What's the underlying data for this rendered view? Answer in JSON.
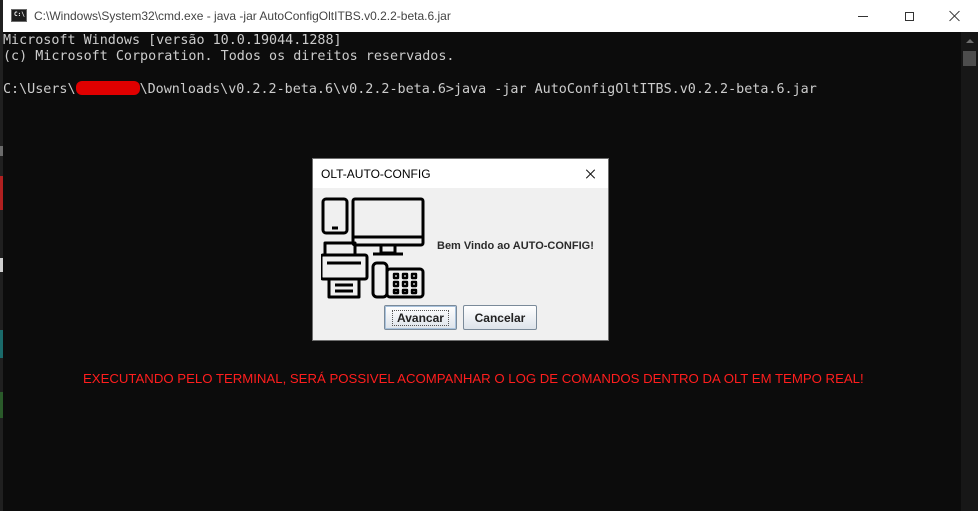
{
  "window": {
    "title": "C:\\Windows\\System32\\cmd.exe - java  -jar AutoConfigOltITBS.v0.2.2-beta.6.jar",
    "icon": "cmd-icon",
    "icon_text": "C:\\",
    "controls": [
      "minimize-icon",
      "maximize-icon",
      "close-icon"
    ]
  },
  "terminal": {
    "line1": "Microsoft Windows [versão 10.0.19044.1288]",
    "line2": "(c) Microsoft Corporation. Todos os direitos reservados.",
    "prompt_prefix": "C:\\Users\\",
    "prompt_suffix": "\\Downloads\\v0.2.2-beta.6\\v0.2.2-beta.6>java -jar AutoConfigOltITBS.v0.2.2-beta.6.jar",
    "redaction_color": "#e00000",
    "text_color": "#cccccc",
    "background": "#0c0c0c"
  },
  "notice": {
    "text": "EXECUTANDO PELO TERMINAL, SERÁ POSSIVEL ACOMPANHAR O LOG DE COMANDOS DENTRO DA OLT EM TEMPO REAL!",
    "color": "#ff1e1e"
  },
  "dialog": {
    "title": "OLT-AUTO-CONFIG",
    "icon": "devices-icon",
    "message": "Bem Vindo ao AUTO-CONFIG!",
    "buttons": {
      "next": "Avancar",
      "cancel": "Cancelar"
    }
  }
}
